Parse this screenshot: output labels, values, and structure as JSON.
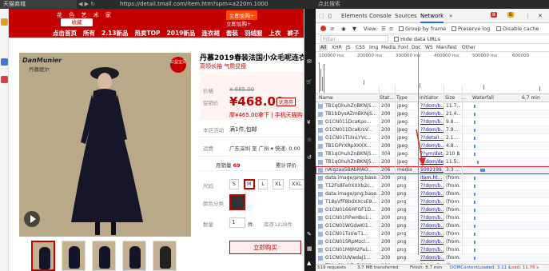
{
  "browser": {
    "tab_title": "天猫商城",
    "nav": "◀ ▶ ↻",
    "url": "https://detail.tmall.com/item.htm?spm=a220m.1000",
    "side_label": "点此搜索"
  },
  "shop": {
    "category_text": "花 色 艺 术 家",
    "favorite": "收藏",
    "add_cart": "立即加购+",
    "add_cart_2": "立即加购+",
    "menu": [
      "点击首页",
      "所有",
      "2.13新品",
      "热卖TOP",
      "2019新品",
      "连衣裙",
      "套装",
      "羽绒服",
      "上衣",
      "裤子"
    ]
  },
  "product": {
    "brand": "DanMunier",
    "brand_cn": "丹慕妮尔",
    "badge": "公益宝贝",
    "title": "丹慕2019春装法国小众毛呢连衣裙",
    "subtitle": "高领长袖 气质显瘦",
    "price_label": "价格",
    "original_price": "¥ 685.00",
    "promo_label": "促销价",
    "promo_price": "¥468.00",
    "coupon": "优惠券",
    "phone_offer": "摩¥465.00拿下 | 手机天猫购",
    "service_label": "本店活动",
    "service": "满1件,包邮",
    "shipping_label": "运费",
    "shipping": "广东深圳 至 广州 ▾  快递: 0.00",
    "monthly_sales_label": "月销量",
    "monthly_sales": "69",
    "reviews_label": "累计评价",
    "size_label": "尺码",
    "sizes": [
      "S",
      "M",
      "L",
      "XL",
      "XXL"
    ],
    "selected_size": "M",
    "color_label": "颜色分类",
    "qty_label": "数量",
    "qty": "1",
    "qty_unit": "件",
    "stock": "库存1228件",
    "buy_button": "立即购买"
  },
  "devtools": {
    "tabs": [
      "Elements",
      "Console",
      "Sources",
      "Network"
    ],
    "active_tab": "Network",
    "errors": "8",
    "warnings": "6",
    "toolbar": {
      "view": "View:",
      "group": "Group by frame",
      "preserve": "Preserve log",
      "disable_cache": "Disable cache"
    },
    "filter_placeholder": "Filter",
    "hide_data_urls": "Hide data URLs",
    "types": [
      "All",
      "XHR",
      "JS",
      "CSS",
      "Img",
      "Media",
      "Font",
      "Doc",
      "WS",
      "Manifest",
      "Other"
    ],
    "ticks": [
      "100000 ms",
      "200000 ms",
      "300000 ms",
      "400000 ms",
      "500000 ms",
      "600000"
    ],
    "columns": [
      "Name",
      "Stat...",
      "Type",
      "Initiator",
      "Size",
      "...",
      "Waterfall",
      "6.7 min"
    ],
    "rows": [
      {
        "name": "TB1qOhuhZnBKNjS...",
        "status": "200",
        "type": "jpeg",
        "initiator": "??dom/b...",
        "size": "11.7..."
      },
      {
        "name": "TB1bDysAZmBKNjS...",
        "status": "200",
        "type": "jpeg",
        "initiator": "??dom/b...",
        "size": "21.4..."
      },
      {
        "name": "O1CN011DcaKpo...",
        "status": "200",
        "type": "jpeg",
        "initiator": "??dom/b...",
        "size": "9.8..."
      },
      {
        "name": "O1CN011DcaKrsV...",
        "status": "200",
        "type": "jpeg",
        "initiator": "??dom/b...",
        "size": "7.9..."
      },
      {
        "name": "O1CN01TUInLYVc...",
        "status": "200",
        "type": "jpeg",
        "initiator": "??detail...",
        "size": "2.1..."
      },
      {
        "name": "TB1GPYXRpXXXX...",
        "status": "200",
        "type": "jpeg",
        "initiator": "??dom/b...",
        "size": "4.8..."
      },
      {
        "name": "TB1qOhuhZnBKNjS...",
        "status": "304",
        "type": "jpeg",
        "initiator": "??ym/det...",
        "size": "210 B"
      },
      {
        "name": "TB1qOhuhZnBKNjS...",
        "status": "200",
        "type": "jpeg",
        "initiator": "??dom/det...",
        "size": "11.5..."
      },
      {
        "name": "nAigzaa5BAbMAO...",
        "status": "206",
        "type": "media",
        "initiator": "5002199...",
        "size": "3.3 ..."
      },
      {
        "name": "data:image/png;base...",
        "status": "200",
        "type": "png",
        "initiator": "item.ht...",
        "size": "(from..."
      },
      {
        "name": "T12Fs8Fe0XXXb2c...",
        "status": "200",
        "type": "png",
        "initiator": "??dom/b...",
        "size": "(from..."
      },
      {
        "name": "data:image/png;base...",
        "status": "200",
        "type": "png",
        "initiator": "??dom/b...",
        "size": "(from..."
      },
      {
        "name": "T18aVfF8bdXXcsE9...",
        "status": "200",
        "type": "png",
        "initiator": "??dom/b...",
        "size": "(from..."
      },
      {
        "name": "O1CN0166HFGF1D...",
        "status": "200",
        "type": "png",
        "initiator": "??dom/b...",
        "size": "(from..."
      },
      {
        "name": "O1CN01RPwHBo1...",
        "status": "200",
        "type": "png",
        "initiator": "??dom/b...",
        "size": "(from..."
      },
      {
        "name": "O1CN01WGdwKI1...",
        "status": "200",
        "type": "png",
        "initiator": "??dom/b...",
        "size": "(from..."
      },
      {
        "name": "O1CN01TuVwT1...",
        "status": "200",
        "type": "png",
        "initiator": "??dom/b...",
        "size": "(from..."
      },
      {
        "name": "O1CN015RpMzcl...",
        "status": "200",
        "type": "png",
        "initiator": "??dom/b...",
        "size": "(from..."
      },
      {
        "name": "O1CN01M8M2Pa1...",
        "status": "200",
        "type": "png",
        "initiator": "??dom/b...",
        "size": "(from..."
      },
      {
        "name": "O1CN01UVwdaJ1...",
        "status": "200",
        "type": "png",
        "initiator": "??dom/b...",
        "size": "(from..."
      },
      {
        "name": "TB1qOhuhZnBKNjS...",
        "status": "200",
        "type": "png",
        "initiator": "??dom/b...",
        "size": "(from..."
      }
    ],
    "status_bar": {
      "requests": "519 requests",
      "transferred": "3.7 MB transferred",
      "finish": "Finish: 8.7 min",
      "dcl": "DOMContentLoaded: 3.11 s",
      "load": "Load: 11.76 s"
    },
    "colors": {
      "accent": "#1a73e8",
      "error": "#d93025",
      "highlight": "#e02020"
    }
  }
}
